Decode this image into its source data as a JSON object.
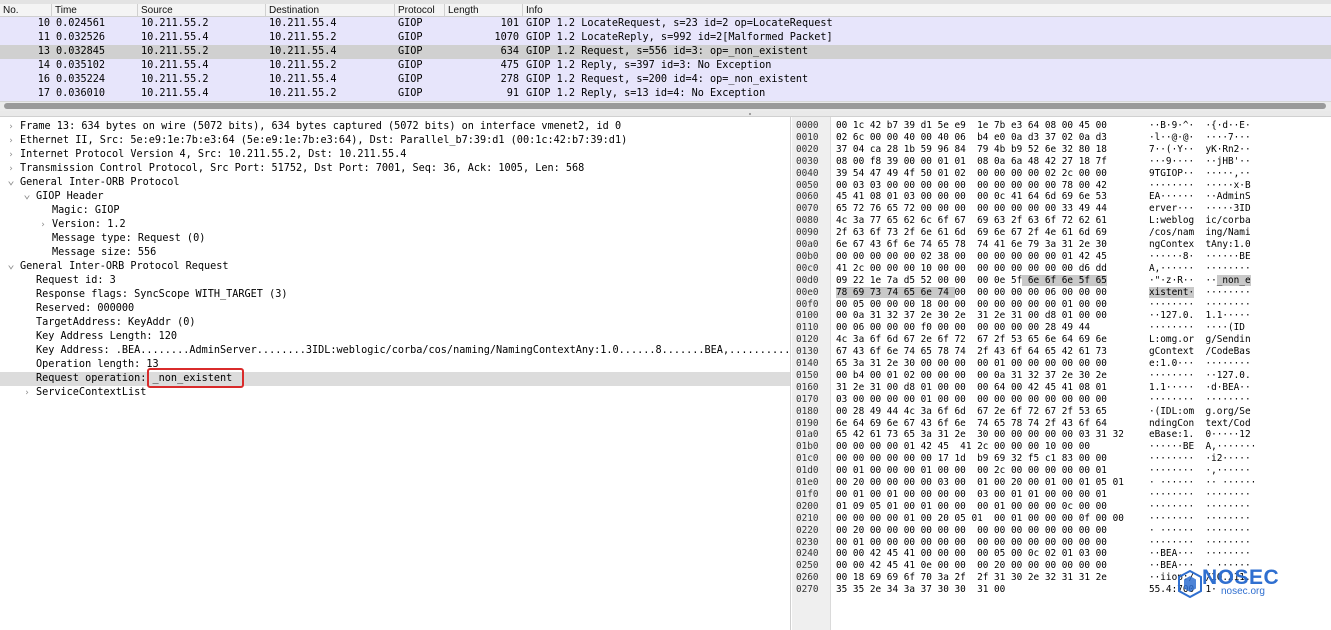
{
  "packet_list": {
    "columns": [
      "No.",
      "Time",
      "Source",
      "Destination",
      "Protocol",
      "Length",
      "Info"
    ],
    "rows": [
      {
        "no": "10",
        "time": "0.024561",
        "src": "10.211.55.2",
        "dst": "10.211.55.4",
        "proto": "GIOP",
        "len": "101",
        "info": "GIOP 1.2 LocateRequest, s=23 id=2 op=LocateRequest",
        "style": "normal"
      },
      {
        "no": "11",
        "time": "0.032526",
        "src": "10.211.55.4",
        "dst": "10.211.55.2",
        "proto": "GIOP",
        "len": "1070",
        "info": "GIOP 1.2 LocateReply, s=992 id=2[Malformed Packet]",
        "style": "normal"
      },
      {
        "no": "13",
        "time": "0.032845",
        "src": "10.211.55.2",
        "dst": "10.211.55.4",
        "proto": "GIOP",
        "len": "634",
        "info": "GIOP 1.2 Request, s=556 id=3: op=_non_existent",
        "style": "selected"
      },
      {
        "no": "14",
        "time": "0.035102",
        "src": "10.211.55.4",
        "dst": "10.211.55.2",
        "proto": "GIOP",
        "len": "475",
        "info": "GIOP 1.2 Reply, s=397 id=3: No Exception",
        "style": "normal"
      },
      {
        "no": "16",
        "time": "0.035224",
        "src": "10.211.55.2",
        "dst": "10.211.55.4",
        "proto": "GIOP",
        "len": "278",
        "info": "GIOP 1.2 Request, s=200 id=4: op=_non_existent",
        "style": "normal"
      },
      {
        "no": "17",
        "time": "0.036010",
        "src": "10.211.55.4",
        "dst": "10.211.55.2",
        "proto": "GIOP",
        "len": "91",
        "info": "GIOP 1.2 Reply, s=13 id=4: No Exception",
        "style": "normal"
      }
    ]
  },
  "details": {
    "rows": [
      {
        "indent": 0,
        "twisty": ">",
        "text": "Frame 13: 634 bytes on wire (5072 bits), 634 bytes captured (5072 bits) on interface vmenet2, id 0"
      },
      {
        "indent": 0,
        "twisty": ">",
        "text": "Ethernet II, Src: 5e:e9:1e:7b:e3:64 (5e:e9:1e:7b:e3:64), Dst: Parallel_b7:39:d1 (00:1c:42:b7:39:d1)"
      },
      {
        "indent": 0,
        "twisty": ">",
        "text": "Internet Protocol Version 4, Src: 10.211.55.2, Dst: 10.211.55.4"
      },
      {
        "indent": 0,
        "twisty": ">",
        "text": "Transmission Control Protocol, Src Port: 51752, Dst Port: 7001, Seq: 36, Ack: 1005, Len: 568"
      },
      {
        "indent": 0,
        "twisty": "v",
        "text": "General Inter-ORB Protocol"
      },
      {
        "indent": 1,
        "twisty": "v",
        "text": "GIOP Header"
      },
      {
        "indent": 2,
        "twisty": "",
        "text": "Magic: GIOP"
      },
      {
        "indent": 2,
        "twisty": ">",
        "text": "Version: 1.2"
      },
      {
        "indent": 2,
        "twisty": "",
        "text": "Message type: Request (0)"
      },
      {
        "indent": 2,
        "twisty": "",
        "text": "Message size: 556"
      },
      {
        "indent": 0,
        "twisty": "v",
        "text": "General Inter-ORB Protocol Request"
      },
      {
        "indent": 1,
        "twisty": "",
        "text": "Request id: 3"
      },
      {
        "indent": 1,
        "twisty": "",
        "text": "Response flags: SyncScope WITH_TARGET (3)"
      },
      {
        "indent": 1,
        "twisty": "",
        "text": "Reserved: 000000"
      },
      {
        "indent": 1,
        "twisty": "",
        "text": "TargetAddress: KeyAddr (0)"
      },
      {
        "indent": 1,
        "twisty": "",
        "text": "Key Address Length: 120"
      },
      {
        "indent": 1,
        "twisty": "",
        "text": "Key Address: .BEA........AdminServer........3IDL:weblogic/corba/cos/naming/NamingContextAny:1.0......8.......BEA,.........."
      },
      {
        "indent": 1,
        "twisty": "",
        "text": "Operation length: 13"
      },
      {
        "indent": 1,
        "twisty": "",
        "text": "Request operation: _non_existent",
        "selected": true
      },
      {
        "indent": 1,
        "twisty": ">",
        "text": "ServiceContextList"
      }
    ]
  },
  "hex": {
    "rows": [
      {
        "off": "0000",
        "bytes": "00 1c 42 b7 39 d1 5e e9  1e 7b e3 64 08 00 45 00",
        "ascii": "··B·9·^·  ·{·d··E·"
      },
      {
        "off": "0010",
        "bytes": "02 6c 00 00 40 00 40 06  b4 e0 0a d3 37 02 0a d3",
        "ascii": "·l··@·@·  ····7···"
      },
      {
        "off": "0020",
        "bytes": "37 04 ca 28 1b 59 96 84  79 4b b9 52 6e 32 80 18",
        "ascii": "7··(·Y··  yK·Rn2··"
      },
      {
        "off": "0030",
        "bytes": "08 00 f8 39 00 00 01 01  08 0a 6a 48 42 27 18 7f",
        "ascii": "···9····  ··jHB'··"
      },
      {
        "off": "0040",
        "bytes": "39 54 47 49 4f 50 01 02  00 00 00 00 02 2c 00 00",
        "ascii": "9TGIOP··  ·····,··"
      },
      {
        "off": "0050",
        "bytes": "00 03 03 00 00 00 00 00  00 00 00 00 00 78 00 42",
        "ascii": "········  ·····x·B"
      },
      {
        "off": "0060",
        "bytes": "45 41 08 01 03 00 00 00  00 0c 41 64 6d 69 6e 53",
        "ascii": "EA······  ··AdminS"
      },
      {
        "off": "0070",
        "bytes": "65 72 76 65 72 00 00 00  00 00 00 00 00 33 49 44",
        "ascii": "erver···  ·····3ID"
      },
      {
        "off": "0080",
        "bytes": "4c 3a 77 65 62 6c 6f 67  69 63 2f 63 6f 72 62 61",
        "ascii": "L:weblog  ic/corba"
      },
      {
        "off": "0090",
        "bytes": "2f 63 6f 73 2f 6e 61 6d  69 6e 67 2f 4e 61 6d 69",
        "ascii": "/cos/nam  ing/Nami"
      },
      {
        "off": "00a0",
        "bytes": "6e 67 43 6f 6e 74 65 78  74 41 6e 79 3a 31 2e 30",
        "ascii": "ngContex  tAny:1.0"
      },
      {
        "off": "00b0",
        "bytes": "00 00 00 00 00 02 38 00  00 00 00 00 00 01 42 45",
        "ascii": "······8·  ······BE"
      },
      {
        "off": "00c0",
        "bytes": "41 2c 00 00 00 10 00 00  00 00 00 00 00 00 d6 dd",
        "ascii": "A,······  ········"
      },
      {
        "off": "00d0",
        "bytes": "09 22 1e 7a d5 52 00 00  00 0e 5f 6e 6f 6e 5f 65",
        "ascii": "·\"·z·R··  ··_non_e",
        "sel_bytes_start": 33,
        "sel_ascii_start": 12
      },
      {
        "off": "00e0",
        "bytes": "78 69 73 74 65 6e 74 00  00 00 00 00 06 00 00 00",
        "ascii": "xistent·  ········",
        "sel_bytes_end": 21,
        "sel_ascii_end": 8
      },
      {
        "off": "00f0",
        "bytes": "00 05 00 00 00 18 00 00  00 00 00 00 00 01 00 00",
        "ascii": "········  ········"
      },
      {
        "off": "0100",
        "bytes": "00 0a 31 32 37 2e 30 2e  31 2e 31 00 d8 01 00 00",
        "ascii": "··127.0.  1.1·····"
      },
      {
        "off": "0110",
        "bytes": "00 06 00 00 00 f0 00 00  00 00 00 00 28 49 44",
        "ascii": "········  ····(ID"
      },
      {
        "off": "0120",
        "bytes": "4c 3a 6f 6d 67 2e 6f 72  67 2f 53 65 6e 64 69 6e",
        "ascii": "L:omg.or  g/Sendin"
      },
      {
        "off": "0130",
        "bytes": "67 43 6f 6e 74 65 78 74  2f 43 6f 64 65 42 61 73",
        "ascii": "gContext  /CodeBas"
      },
      {
        "off": "0140",
        "bytes": "65 3a 31 2e 30 00 00 00  00 01 00 00 00 00 00 00",
        "ascii": "e:1.0···  ········"
      },
      {
        "off": "0150",
        "bytes": "00 b4 00 01 02 00 00 00  00 0a 31 32 37 2e 30 2e",
        "ascii": "········  ··127.0."
      },
      {
        "off": "0160",
        "bytes": "31 2e 31 00 d8 01 00 00  00 64 00 42 45 41 08 01",
        "ascii": "1.1·····  ·d·BEA··"
      },
      {
        "off": "0170",
        "bytes": "03 00 00 00 00 01 00 00  00 00 00 00 00 00 00 00",
        "ascii": "········  ········"
      },
      {
        "off": "0180",
        "bytes": "00 28 49 44 4c 3a 6f 6d  67 2e 6f 72 67 2f 53 65",
        "ascii": "·(IDL:om  g.org/Se"
      },
      {
        "off": "0190",
        "bytes": "6e 64 69 6e 67 43 6f 6e  74 65 78 74 2f 43 6f 64",
        "ascii": "ndingCon  text/Cod"
      },
      {
        "off": "01a0",
        "bytes": "65 42 61 73 65 3a 31 2e  30 00 00 00 00 00 03 31 32",
        "ascii": "eBase:1.  0·····12"
      },
      {
        "off": "01b0",
        "bytes": "00 00 00 00 01 42 45  41 2c 00 00 00 10 00 00",
        "ascii": "······BE  A,·······"
      },
      {
        "off": "01c0",
        "bytes": "00 00 00 00 00 00 17 1d  b9 69 32 f5 c1 83 00 00",
        "ascii": "········  ·i2·····"
      },
      {
        "off": "01d0",
        "bytes": "00 01 00 00 00 01 00 00  00 2c 00 00 00 00 00 01",
        "ascii": "········  ·,······"
      },
      {
        "off": "01e0",
        "bytes": "00 20 00 00 00 00 03 00  01 00 20 00 01 00 01 05 01",
        "ascii": "· ······  ·· ······"
      },
      {
        "off": "01f0",
        "bytes": "00 01 00 01 00 00 00 00  03 00 01 01 00 00 00 01",
        "ascii": "········  ········"
      },
      {
        "off": "0200",
        "bytes": "01 09 05 01 00 01 00 00  00 01 00 00 00 0c 00 00",
        "ascii": "········  ········"
      },
      {
        "off": "0210",
        "bytes": "00 00 00 00 01 00 20 05 01  00 01 00 00 00 0f 00 00",
        "ascii": "········  ········"
      },
      {
        "off": "0220",
        "bytes": "00 20 00 00 00 00 00 00  00 00 00 00 00 00 00 00",
        "ascii": "· ······  ········"
      },
      {
        "off": "0230",
        "bytes": "00 01 00 00 00 00 00 00  00 00 00 00 00 00 00 00",
        "ascii": "········  ········"
      },
      {
        "off": "0240",
        "bytes": "00 00 42 45 41 00 00 00  00 05 00 0c 02 01 03 00",
        "ascii": "··BEA···  ········"
      },
      {
        "off": "0250",
        "bytes": "00 00 42 45 41 0e 00 00  00 20 00 00 00 00 00 00",
        "ascii": "··BEA···  · ······"
      },
      {
        "off": "0260",
        "bytes": "00 18 69 69 6f 70 3a 2f  2f 31 30 2e 32 31 31 2e",
        "ascii": "··iiop:/  /10.211."
      },
      {
        "off": "0270",
        "bytes": "35 35 2e 34 3a 37 30 30  31 00",
        "ascii": "55.4:700  1·"
      }
    ]
  },
  "watermark": {
    "name": "NOSEC",
    "url": "nosec.org",
    "icon": "nosec-shield-logo"
  },
  "colors": {
    "row_tint": "#e7e5fb",
    "row_selected": "#d0d0d0",
    "row_alt": "#ebe8fc",
    "details_selected": "#dcdcdc",
    "highlight_box": "#d92b2b",
    "brand": "#2f6fd0"
  }
}
